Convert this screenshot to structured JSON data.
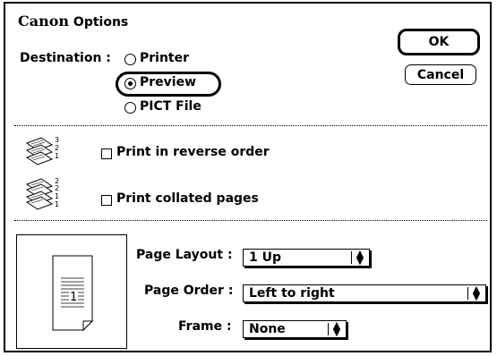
{
  "dialog": {
    "brand": "Canon",
    "title_rest": " Options",
    "ok_label": "OK",
    "cancel_label": "Cancel"
  },
  "destination": {
    "label": "Destination :",
    "options": [
      {
        "label": "Printer",
        "selected": false
      },
      {
        "label": "Preview",
        "selected": true
      },
      {
        "label": "PICT File",
        "selected": false
      }
    ]
  },
  "print_options": {
    "reverse_label": "Print in reverse order",
    "reverse_checked": false,
    "collated_label": "Print collated pages",
    "collated_checked": false,
    "reverse_icon_digits": [
      "3",
      "2",
      "1"
    ],
    "collated_icon_digits": [
      "2",
      "2",
      "1",
      "1"
    ]
  },
  "layout": {
    "page_layout_label": "Page Layout :",
    "page_layout_value": "1 Up",
    "page_order_label": "Page Order :",
    "page_order_value": "Left to right",
    "frame_label": "Frame :",
    "frame_value": "None",
    "preview_page_number": "1"
  },
  "icons": {
    "popup_arrows": "up-down-arrows-icon",
    "stack_icon": "page-stack-icon"
  }
}
